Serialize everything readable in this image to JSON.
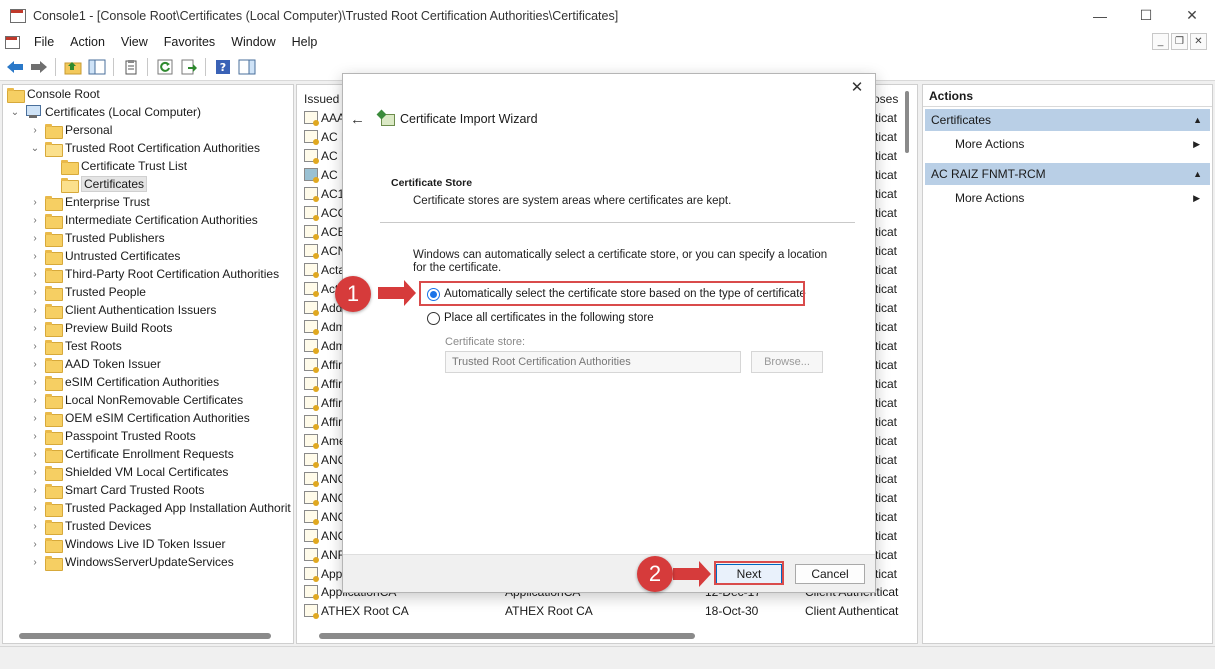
{
  "window": {
    "title": "Console1 - [Console Root\\Certificates (Local Computer)\\Trusted Root Certification Authorities\\Certificates]",
    "minimize": "—",
    "maximize": "☐",
    "close": "✕"
  },
  "menu": [
    "File",
    "Action",
    "View",
    "Favorites",
    "Window",
    "Help"
  ],
  "mdi": {
    "minimize": "_",
    "restore": "❐",
    "close": "✕"
  },
  "tree": {
    "root": "Console Root",
    "computer": "Certificates (Local Computer)",
    "personal": "Personal",
    "trusted_root": "Trusted Root Certification Authorities",
    "ctl": "Certificate Trust List",
    "certificates": "Certificates",
    "items": [
      "Enterprise Trust",
      "Intermediate Certification Authorities",
      "Trusted Publishers",
      "Untrusted Certificates",
      "Third-Party Root Certification Authorities",
      "Trusted People",
      "Client Authentication Issuers",
      "Preview Build Roots",
      "Test Roots",
      "AAD Token Issuer",
      "eSIM Certification Authorities",
      "Local NonRemovable Certificates",
      "OEM eSIM Certification Authorities",
      "Passpoint Trusted Roots",
      "Certificate Enrollment Requests",
      "Shielded VM Local Certificates",
      "Smart Card Trusted Roots",
      "Trusted Packaged App Installation Authorit",
      "Trusted Devices",
      "Windows Live ID Token Issuer",
      "WindowsServerUpdateServices"
    ]
  },
  "center": {
    "col_issued_to": "Issued T",
    "col_purposes": "oses",
    "rows": [
      "AAA",
      "AC R",
      "AC R",
      "AC R",
      "AC1",
      "ACC",
      "ACE",
      "ACN",
      "Acta",
      "Act",
      "Add",
      "Adm",
      "Adm",
      "Affir",
      "Affir",
      "Affir",
      "Affir",
      "Ame",
      "ANC",
      "ANC",
      "ANC",
      "ANC",
      "ANC",
      "ANF",
      "App"
    ],
    "right_col": [
      "ticat",
      "ticat",
      "ticat",
      "ticat",
      "ticat",
      "ticat",
      "ticat",
      "ticat",
      "ticat",
      "ticat",
      "ticat",
      "ticat",
      "ticat",
      "ticat",
      "ticat",
      "ticat",
      "ticat",
      "ticat",
      "ticat",
      "ticat",
      "ticat",
      "ticat",
      "ticat",
      "ticat",
      "ticat"
    ],
    "partial_row": {
      "name": "ApplicationCA",
      "issued_by": "ApplicationCA",
      "expiration": "12-Dec-17",
      "purposes": "Client Authenticat"
    },
    "last_row": {
      "name": "ATHEX Root CA",
      "issued_by": "ATHEX Root CA",
      "expiration": "18-Oct-30",
      "purposes": "Client Authenticat"
    }
  },
  "actions": {
    "title": "Actions",
    "section1": "Certificates",
    "section1_item": "More Actions",
    "section2": "AC RAIZ FNMT-RCM",
    "section2_item": "More Actions"
  },
  "dialog": {
    "title": "Certificate Import Wizard",
    "close": "✕",
    "back": "←",
    "section_heading": "Certificate Store",
    "section_sub": "Certificate stores are system areas where certificates are kept.",
    "description": "Windows can automatically select a certificate store, or you can specify a location for the certificate.",
    "radio_auto": "Automatically select the certificate store based on the type of certificate",
    "radio_manual": "Place all certificates in the following store",
    "store_label": "Certificate store:",
    "store_value": "Trusted Root Certification Authorities",
    "browse": "Browse...",
    "next": "Next",
    "cancel": "Cancel"
  },
  "annotations": {
    "step1": "1",
    "step2": "2"
  },
  "colors": {
    "highlight": "#d94b4b",
    "callout": "#d63b3b",
    "accent": "#0067c0",
    "actions_header": "#b9cfe6"
  }
}
